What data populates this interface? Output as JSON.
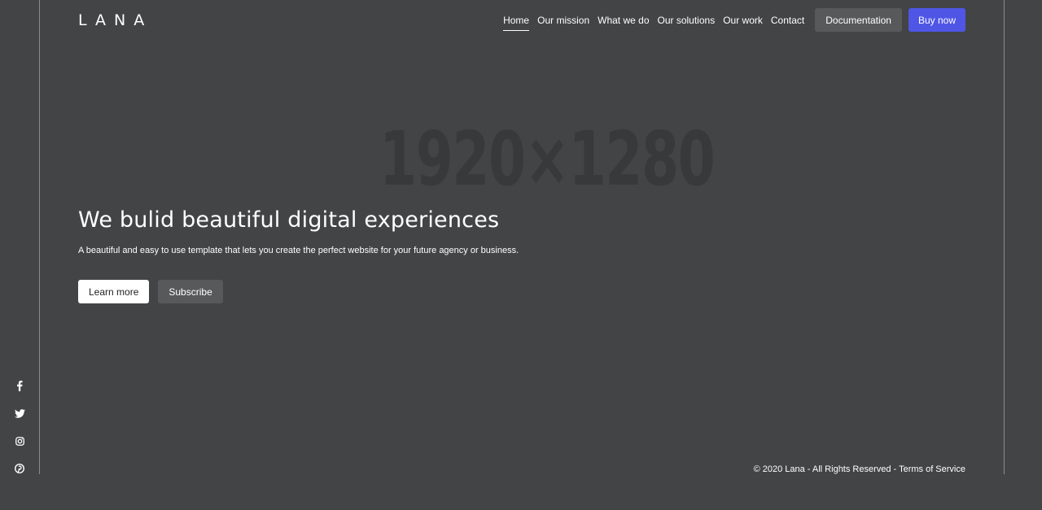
{
  "brand": {
    "logo": "LANA"
  },
  "background_placeholder": "1920×1280",
  "nav": {
    "links": [
      {
        "label": "Home",
        "active": true
      },
      {
        "label": "Our mission"
      },
      {
        "label": "What we do"
      },
      {
        "label": "Our solutions"
      },
      {
        "label": "Our work"
      },
      {
        "label": "Contact"
      }
    ],
    "documentation_label": "Documentation",
    "buy_label": "Buy now"
  },
  "hero": {
    "title": "We bulid beautiful digital experiences",
    "subtitle": "A beautiful and easy to use template that lets you create the perfect website for your future agency or business.",
    "primary_button": "Learn more",
    "secondary_button": "Subscribe"
  },
  "social": {
    "icons": [
      "facebook-icon",
      "twitter-icon",
      "instagram-icon",
      "pinterest-icon"
    ]
  },
  "footer": {
    "copyright": "© 2020 Lana - All Rights Reserved - ",
    "terms_label": "Terms of Service"
  },
  "colors": {
    "background": "#434446",
    "accent": "#4f56e6",
    "secondary_button": "#58595b",
    "divider": "#8a8b8d"
  }
}
